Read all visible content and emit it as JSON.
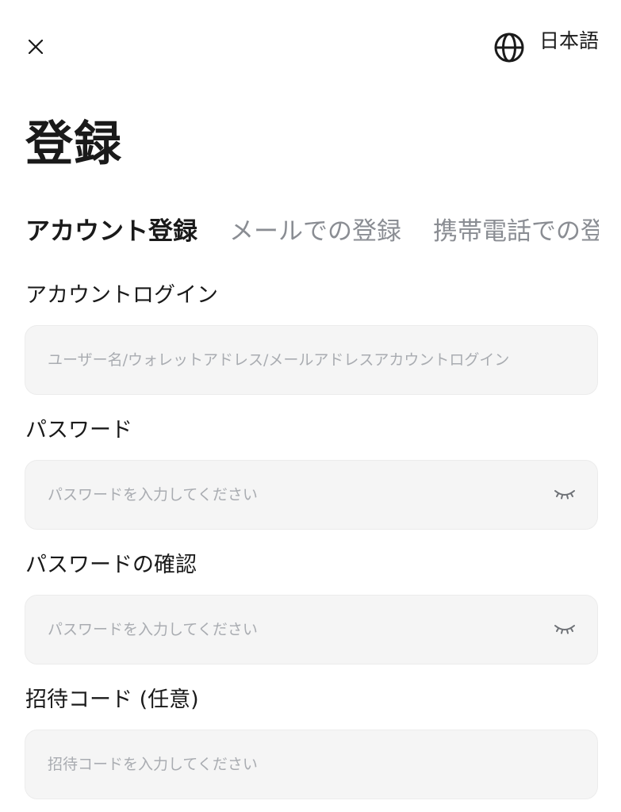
{
  "header": {
    "close_icon": "close-icon",
    "language_icon": "globe-icon",
    "language_label": "日本語"
  },
  "page": {
    "title": "登録"
  },
  "tabs": [
    {
      "label": "アカウント登録",
      "active": true
    },
    {
      "label": "メールでの登録",
      "active": false
    },
    {
      "label": "携帯電話での登録",
      "active": false
    }
  ],
  "form": {
    "account": {
      "label": "アカウントログイン",
      "placeholder": "ユーザー名/ウォレットアドレス/メールアドレスアカウントログイン",
      "value": ""
    },
    "password": {
      "label": "パスワード",
      "placeholder": "パスワードを入力してください",
      "value": "",
      "toggle_icon": "eye-closed-icon"
    },
    "password_confirm": {
      "label": "パスワードの確認",
      "placeholder": "パスワードを入力してください",
      "value": "",
      "toggle_icon": "eye-closed-icon"
    },
    "invite_code": {
      "label": "招待コード (任意)",
      "placeholder": "招待コードを入力してください",
      "value": ""
    }
  },
  "colors": {
    "text_primary": "#1a1a1a",
    "text_muted": "#8a8d93",
    "placeholder": "#a9acb1",
    "field_background": "#f5f5f5"
  }
}
